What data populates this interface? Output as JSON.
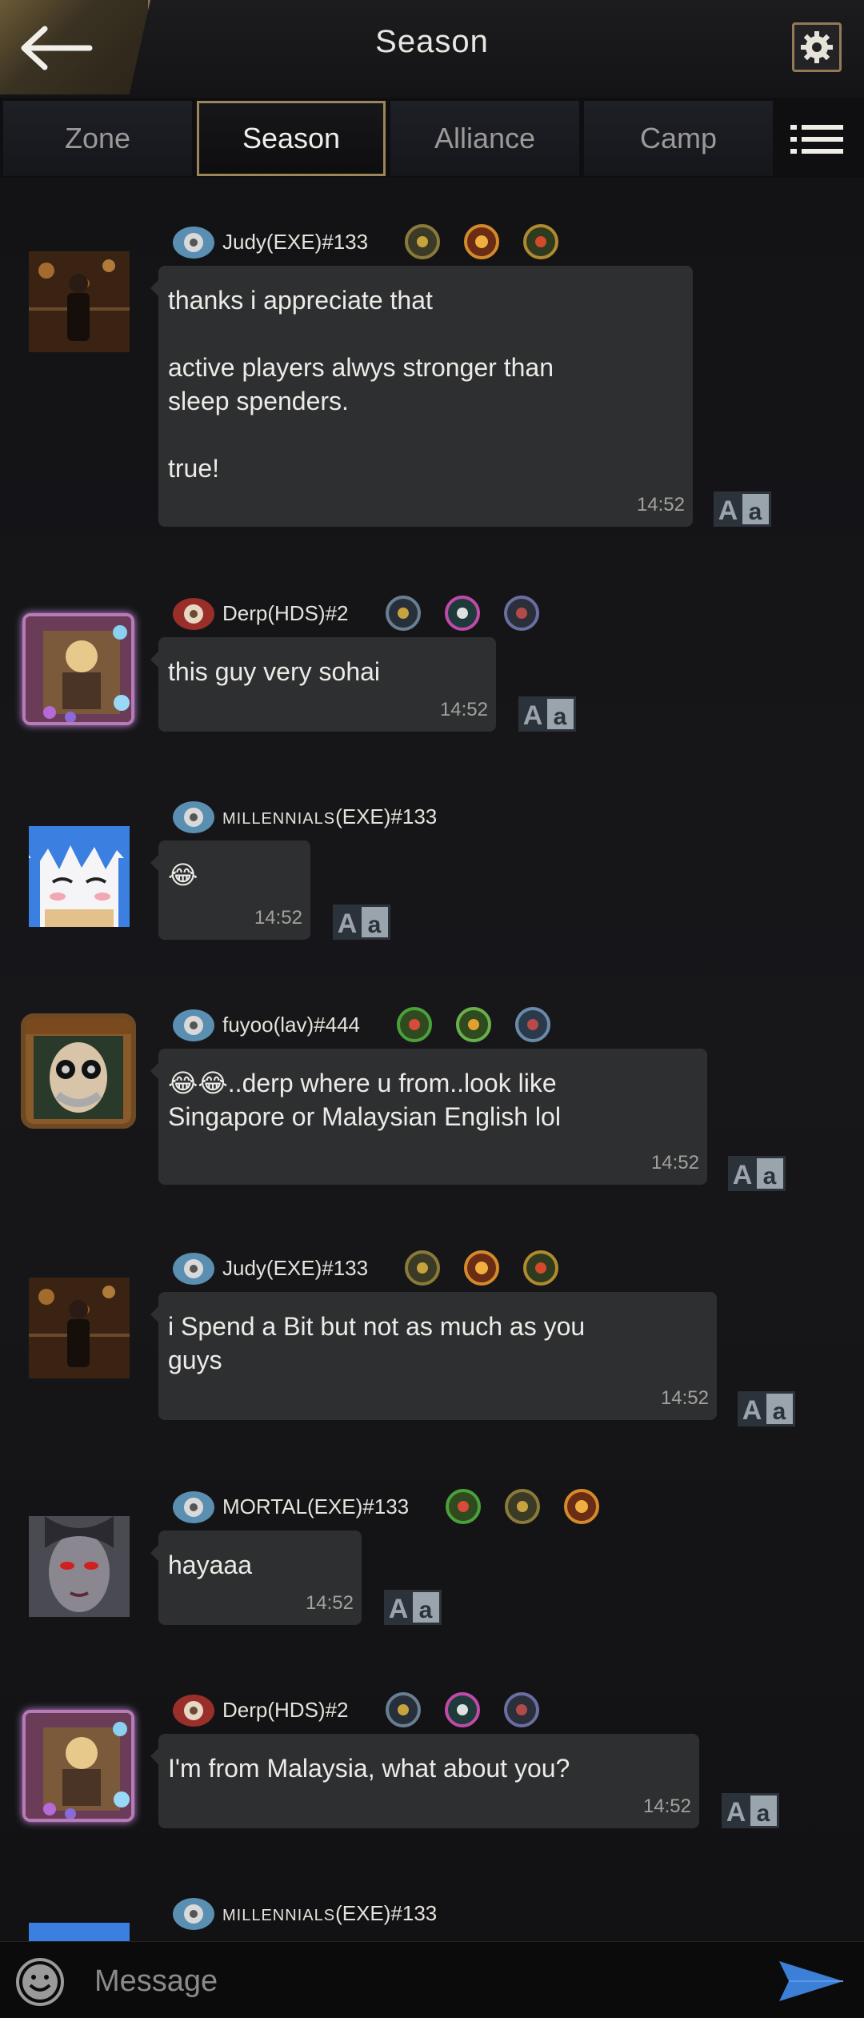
{
  "header": {
    "title": "Season"
  },
  "tabs": [
    {
      "label": "Zone",
      "active": false
    },
    {
      "label": "Season",
      "active": true
    },
    {
      "label": "Alliance",
      "active": false
    },
    {
      "label": "Camp",
      "active": false
    }
  ],
  "messages": [
    {
      "user": "Judy(EXE)#133",
      "text": "thanks i appreciate that\n\nactive players alwys stronger than\nsleep spenders.\n\ntrue!",
      "time": "14:52"
    },
    {
      "user": "Derp(HDS)#2",
      "text": "this guy very sohai",
      "time": "14:52"
    },
    {
      "user_prefix": "MILLENNIALS",
      "user_suffix": "(EXE)#133",
      "text": "😂",
      "time": "14:52"
    },
    {
      "user": "fuyoo(lav)#444",
      "text": "😂😂..derp where u from..look like\nSingapore or Malaysian English lol",
      "time": "14:52"
    },
    {
      "user": "Judy(EXE)#133",
      "text": "i Spend a Bit but not as much as you\nguys",
      "time": "14:52"
    },
    {
      "user": "MORTAL(EXE)#133",
      "text": "hayaaa",
      "time": "14:52"
    },
    {
      "user": "Derp(HDS)#2",
      "text": "I'm from Malaysia, what about you?",
      "time": "14:52"
    },
    {
      "user_prefix": "MILLENNIALS",
      "user_suffix": "(EXE)#133"
    }
  ],
  "translate_label": "Aa",
  "input": {
    "placeholder": "Message"
  },
  "colors": {
    "accent_gold": "#9b8659",
    "bubble": "#2e2f31",
    "background": "#141416"
  }
}
